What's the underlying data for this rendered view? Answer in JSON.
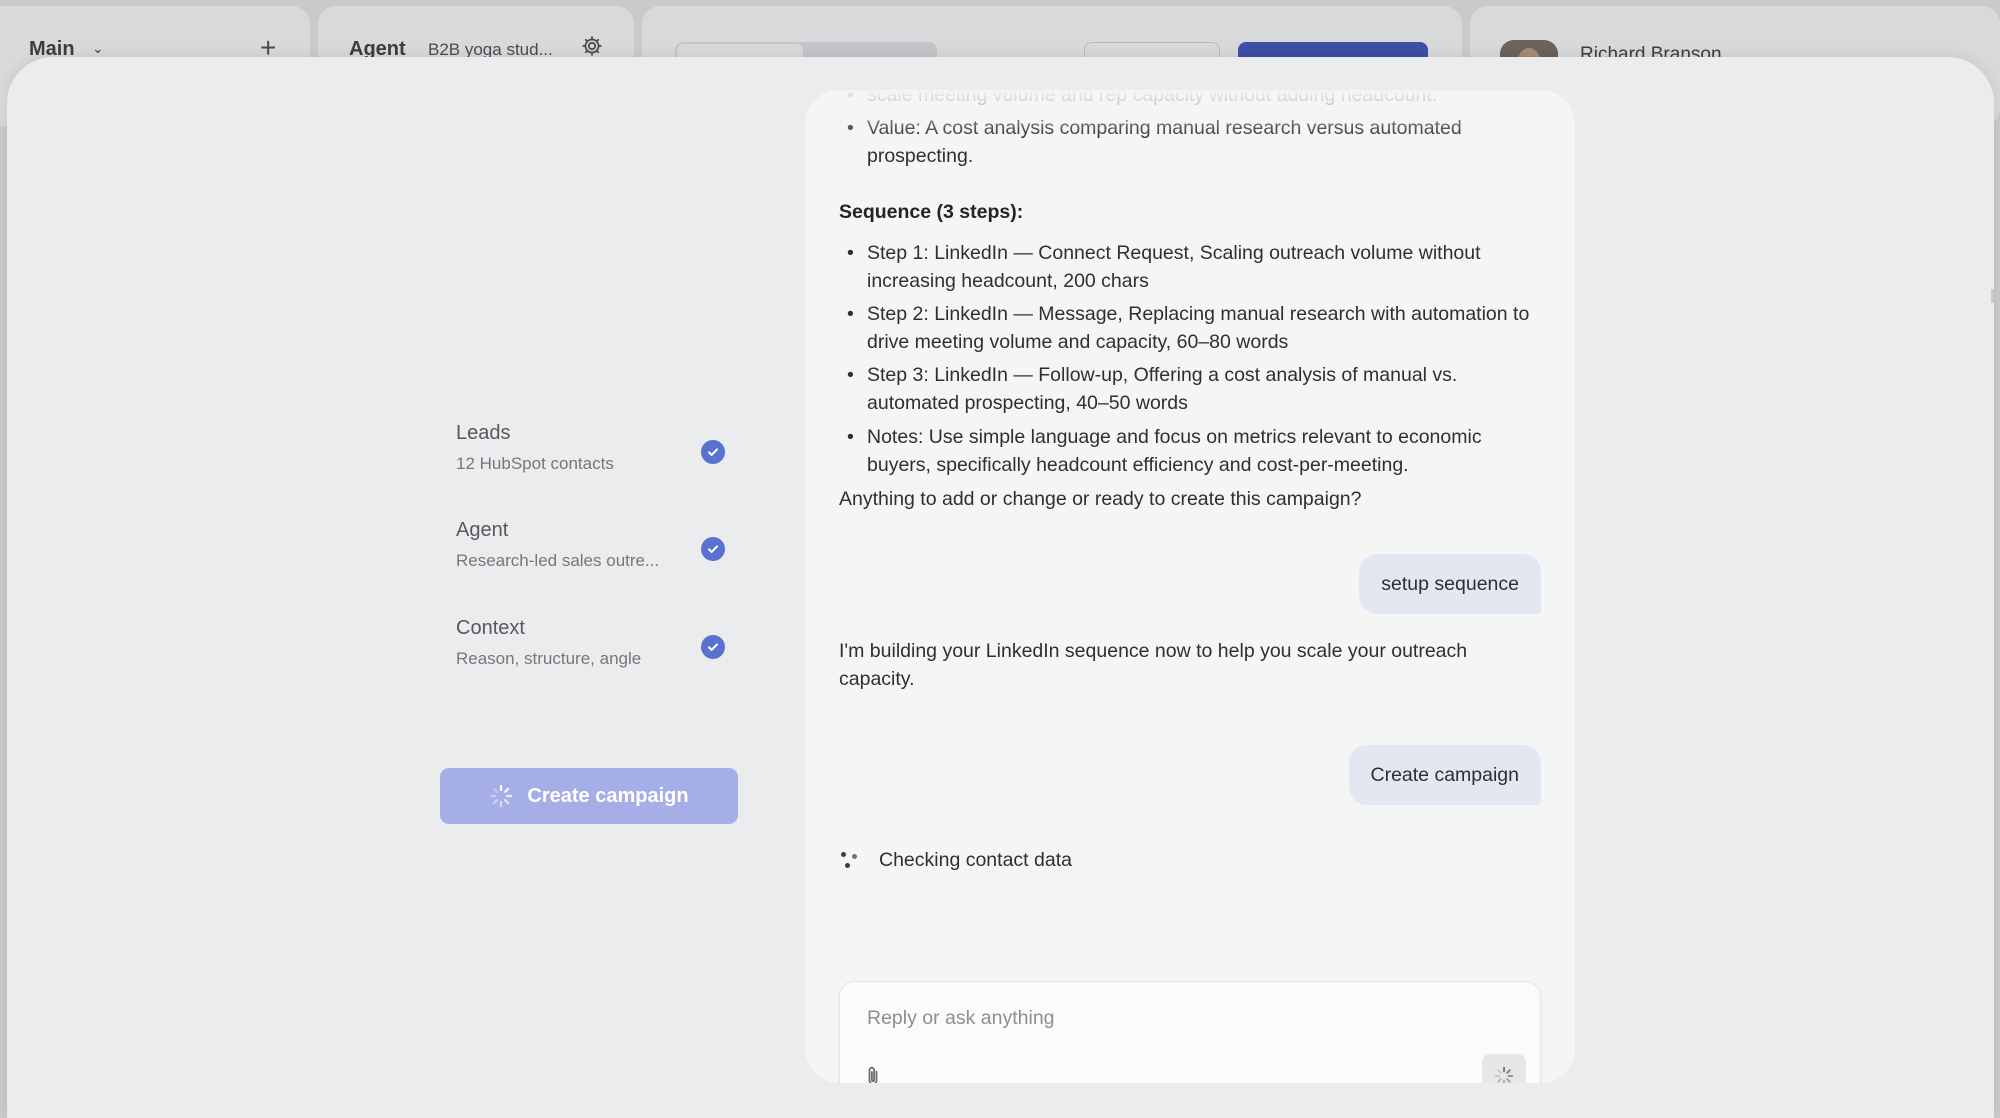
{
  "background_app": {
    "main_label": "Main",
    "agent_label": "Agent",
    "agent_sub": "B2B yoga stud...",
    "user_name": "Richard Branson"
  },
  "checklist": [
    {
      "title": "Leads",
      "subtitle": "12 HubSpot contacts",
      "done": true
    },
    {
      "title": "Agent",
      "subtitle": "Research-led sales outre...",
      "done": true
    },
    {
      "title": "Context",
      "subtitle": "Reason, structure, angle",
      "done": true
    }
  ],
  "create_button": {
    "label": "Create campaign",
    "state": "loading"
  },
  "chat": {
    "top_cut_bullet": "scale meeting volume and rep capacity without adding headcount.",
    "value_bullet": "Value: A cost analysis comparing manual research versus automated prospecting.",
    "sequence_heading": "Sequence (3 steps):",
    "sequence_items": [
      "Step 1: LinkedIn — Connect Request, Scaling outreach volume without increasing headcount, 200 chars",
      "Step 2: LinkedIn — Message, Replacing manual research with automation to drive meeting volume and capacity, 60–80 words",
      "Step 3: LinkedIn — Follow-up, Offering a cost analysis of manual vs. automated prospecting, 40–50 words",
      "Notes: Use simple language and focus on metrics relevant to economic buyers, specifically headcount efficiency and cost-per-meeting."
    ],
    "question": "Anything to add or change or ready to create this campaign?",
    "user_msg_1": "setup sequence",
    "assistant_reply": "I'm building your LinkedIn sequence now to help you scale your outreach capacity.",
    "user_msg_2": "Create campaign",
    "status_text": "Checking contact data"
  },
  "composer": {
    "placeholder": "Reply or ask anything",
    "value": ""
  },
  "colors": {
    "accent": "#5a72cf",
    "button_loading": "#a6aee8",
    "user_bubble": "#e4e6f2"
  }
}
